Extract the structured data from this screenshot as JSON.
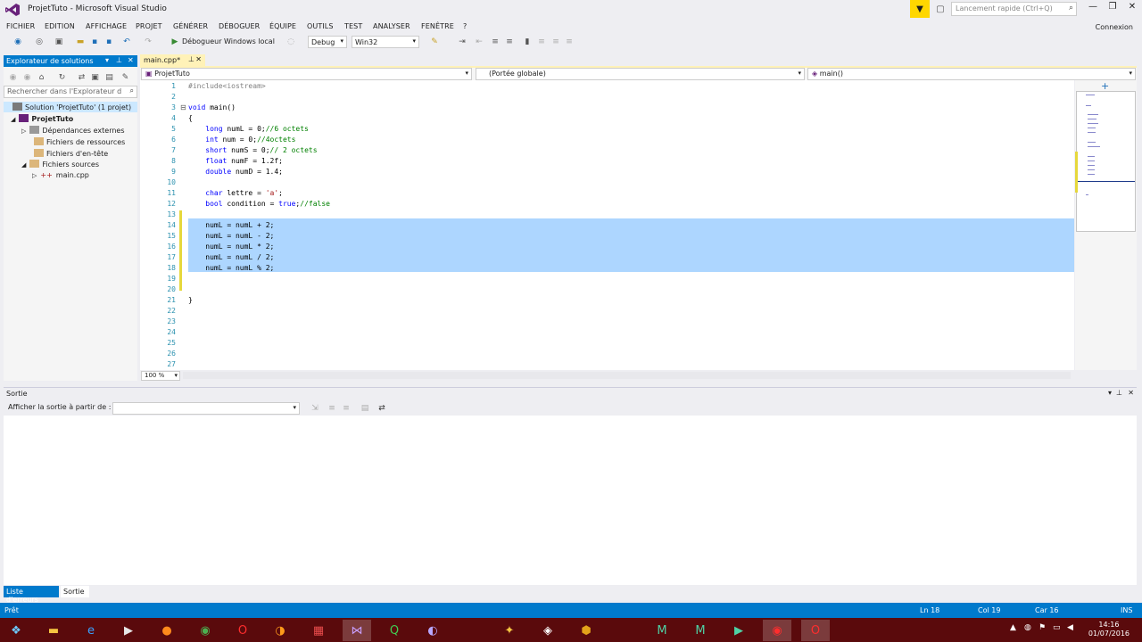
{
  "window": {
    "title": "ProjetTuto - Microsoft Visual Studio",
    "quick_launch_placeholder": "Lancement rapide (Ctrl+Q)",
    "connexion": "Connexion"
  },
  "menu": [
    "FICHIER",
    "EDITION",
    "AFFICHAGE",
    "PROJET",
    "GÉNÉRER",
    "DÉBOGUER",
    "ÉQUIPE",
    "OUTILS",
    "TEST",
    "ANALYSER",
    "FENÊTRE",
    "?"
  ],
  "toolbar": {
    "debugger_label": "Débogueur Windows local",
    "config": "Debug",
    "platform": "Win32"
  },
  "solution_explorer": {
    "title": "Explorateur de solutions",
    "search_placeholder": "Rechercher dans l'Explorateur d",
    "items": [
      {
        "label": "Solution 'ProjetTuto' (1 projet)"
      },
      {
        "label": "ProjetTuto"
      },
      {
        "label": "Dépendances externes"
      },
      {
        "label": "Fichiers de ressources"
      },
      {
        "label": "Fichiers d'en-tête"
      },
      {
        "label": "Fichiers sources"
      },
      {
        "label": "main.cpp"
      }
    ]
  },
  "editor": {
    "tab_label": "main.cpp*",
    "nav_project": "ProjetTuto",
    "nav_scope": "(Portée globale)",
    "nav_member": "main()",
    "zoom": "100 %",
    "line_numbers": [
      "1",
      "2",
      "3",
      "4",
      "5",
      "6",
      "7",
      "8",
      "9",
      "10",
      "11",
      "12",
      "13",
      "14",
      "15",
      "16",
      "17",
      "18",
      "19",
      "20",
      "21",
      "22",
      "23",
      "24",
      "25",
      "26",
      "27"
    ],
    "lines": [
      "#include<iostream>",
      "",
      "void main()",
      "{",
      "    long numL = 0;//6 octets",
      "    int num = 0;//4octets",
      "    short numS = 0;// 2 octets",
      "    float numF = 1.2f;",
      "    double numD = 1.4;",
      "",
      "    char lettre = 'a';",
      "    bool condition = true;//false",
      "",
      "    numL = numL + 2;",
      "    numL = numL - 2;",
      "    numL = numL * 2;",
      "    numL = numL / 2;",
      "    numL = numL % 2;",
      "",
      "",
      "}",
      "",
      "",
      "",
      "",
      "",
      ""
    ]
  },
  "output": {
    "title": "Sortie",
    "show_from_label": "Afficher la sortie à partir de :",
    "show_from_value": ""
  },
  "bottom_tabs": [
    "Liste d'erreurs",
    "Sortie"
  ],
  "status": {
    "ready": "Prêt",
    "ln": "Ln 18",
    "col": "Col 19",
    "car": "Car 16",
    "ins": "INS"
  },
  "clock": {
    "time": "14:16",
    "date": "01/07/2016"
  },
  "colors": {
    "accent": "#007acc",
    "selection": "#add6ff",
    "tab_active": "#fff2b8",
    "taskbar": "#5a0a0c"
  }
}
